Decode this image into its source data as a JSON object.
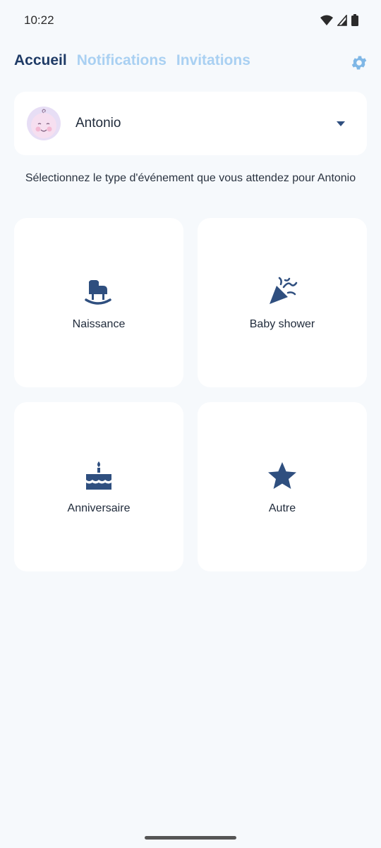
{
  "status": {
    "time": "10:22"
  },
  "tabs": [
    {
      "label": "Accueil"
    },
    {
      "label": "Notifications"
    },
    {
      "label": "Invitations"
    }
  ],
  "profile": {
    "name": "Antonio"
  },
  "instruction": "Sélectionnez le type d'événement que vous attendez pour Antonio",
  "cards": [
    {
      "label": "Naissance",
      "icon": "cradle-icon"
    },
    {
      "label": "Baby shower",
      "icon": "party-popper-icon"
    },
    {
      "label": "Anniversaire",
      "icon": "birthday-cake-icon"
    },
    {
      "label": "Autre",
      "icon": "star-icon"
    }
  ],
  "colors": {
    "primary": "#1f3b66",
    "tab_inactive": "#a9d0f2",
    "icon": "#2f4f7f",
    "background": "#f6f9fc"
  }
}
